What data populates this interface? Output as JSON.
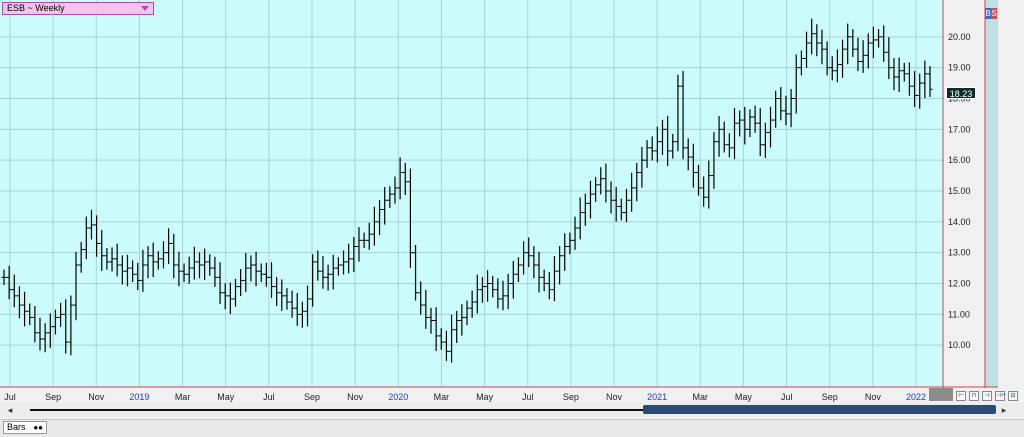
{
  "header": {
    "symbol_label": "ESB ~ Weekly",
    "bs_badge": {
      "b": "B",
      "s": "S"
    }
  },
  "price_tag": "18.23",
  "footer": {
    "tab_label": "Bars",
    "tab_icon": "binoculars-icon",
    "scroll_left": "◂",
    "scroll_right": "▸"
  },
  "tool_buttons": [
    "⊢",
    "⊓",
    "⊣",
    "⊣⊢",
    "⊟"
  ],
  "colors": {
    "plot_bg": "#ccfbfc",
    "grid": "#a9d3d3",
    "bars": "#000000",
    "axis_border": "#d6404a",
    "year_label": "#1f3fd0",
    "right_strip": "#bde0e3"
  },
  "chart_data": {
    "type": "bar",
    "subtype": "ohlc",
    "title": "",
    "y_axis": {
      "side": "right",
      "ticks": [
        "10.00",
        "11.00",
        "12.00",
        "13.00",
        "14.00",
        "15.00",
        "16.00",
        "17.00",
        "18.00",
        "19.00",
        "20.00"
      ],
      "ylim": [
        9.0,
        21.0
      ]
    },
    "x_axis": {
      "labels": [
        {
          "text": "Jul",
          "year": false
        },
        {
          "text": "Sep",
          "year": false
        },
        {
          "text": "Nov",
          "year": false
        },
        {
          "text": "2019",
          "year": true
        },
        {
          "text": "Mar",
          "year": false
        },
        {
          "text": "May",
          "year": false
        },
        {
          "text": "Jul",
          "year": false
        },
        {
          "text": "Sep",
          "year": false
        },
        {
          "text": "Nov",
          "year": false
        },
        {
          "text": "2020",
          "year": true
        },
        {
          "text": "Mar",
          "year": false
        },
        {
          "text": "May",
          "year": false
        },
        {
          "text": "Jul",
          "year": false
        },
        {
          "text": "Sep",
          "year": false
        },
        {
          "text": "Nov",
          "year": false
        },
        {
          "text": "2021",
          "year": true
        },
        {
          "text": "Mar",
          "year": false
        },
        {
          "text": "May",
          "year": false
        },
        {
          "text": "Jul",
          "year": false
        },
        {
          "text": "Sep",
          "year": false
        },
        {
          "text": "Nov",
          "year": false
        },
        {
          "text": "2022",
          "year": true
        }
      ]
    },
    "grid": true,
    "last_price": 18.23,
    "series": [
      {
        "closes": [
          12.2,
          11.8,
          11.6,
          11.3,
          11.1,
          10.9,
          10.4,
          10.2,
          10.4,
          10.6,
          10.9,
          11.0,
          10.1,
          11.3,
          12.6,
          13.1,
          13.8,
          13.9,
          13.3,
          12.9,
          12.7,
          12.8,
          12.6,
          12.4,
          12.5,
          12.3,
          12.1,
          12.6,
          12.9,
          12.7,
          12.8,
          13.0,
          13.3,
          12.6,
          12.4,
          12.3,
          12.5,
          12.7,
          12.6,
          12.7,
          12.5,
          12.2,
          11.7,
          11.6,
          11.5,
          11.9,
          12.1,
          12.5,
          12.6,
          12.4,
          12.3,
          12.2,
          11.9,
          11.7,
          11.6,
          11.4,
          11.2,
          11.0,
          11.1,
          11.5,
          12.7,
          12.4,
          12.2,
          12.3,
          12.5,
          12.6,
          12.7,
          12.8,
          13.2,
          13.4,
          13.4,
          13.6,
          14.0,
          14.4,
          14.7,
          14.9,
          15.1,
          15.6,
          15.3,
          13.0,
          11.7,
          11.3,
          10.9,
          10.8,
          10.3,
          10.1,
          9.8,
          10.5,
          10.8,
          10.9,
          11.2,
          11.4,
          11.8,
          11.9,
          12.0,
          11.8,
          11.5,
          11.6,
          12.0,
          12.3,
          12.6,
          13.0,
          12.9,
          12.6,
          12.2,
          12.0,
          11.8,
          12.4,
          12.9,
          13.2,
          13.4,
          13.8,
          14.3,
          14.6,
          14.9,
          15.2,
          15.4,
          15.0,
          14.7,
          14.5,
          14.3,
          14.7,
          15.1,
          15.6,
          16.0,
          16.4,
          16.3,
          16.6,
          17.0,
          16.3,
          16.6,
          18.4,
          16.4,
          16.1,
          15.6,
          15.1,
          14.8,
          15.5,
          16.6,
          17.0,
          16.5,
          16.4,
          17.2,
          17.3,
          17.0,
          17.4,
          17.2,
          16.5,
          16.9,
          17.3,
          18.0,
          17.6,
          17.5,
          18.0,
          19.0,
          19.3,
          19.8,
          20.1,
          19.8,
          19.6,
          19.0,
          18.9,
          19.1,
          19.6,
          20.0,
          19.6,
          19.2,
          19.4,
          19.8,
          19.9,
          20.0,
          19.5,
          19.0,
          18.7,
          18.9,
          18.8,
          18.4,
          18.1,
          18.5,
          18.8,
          18.3
        ]
      }
    ]
  }
}
